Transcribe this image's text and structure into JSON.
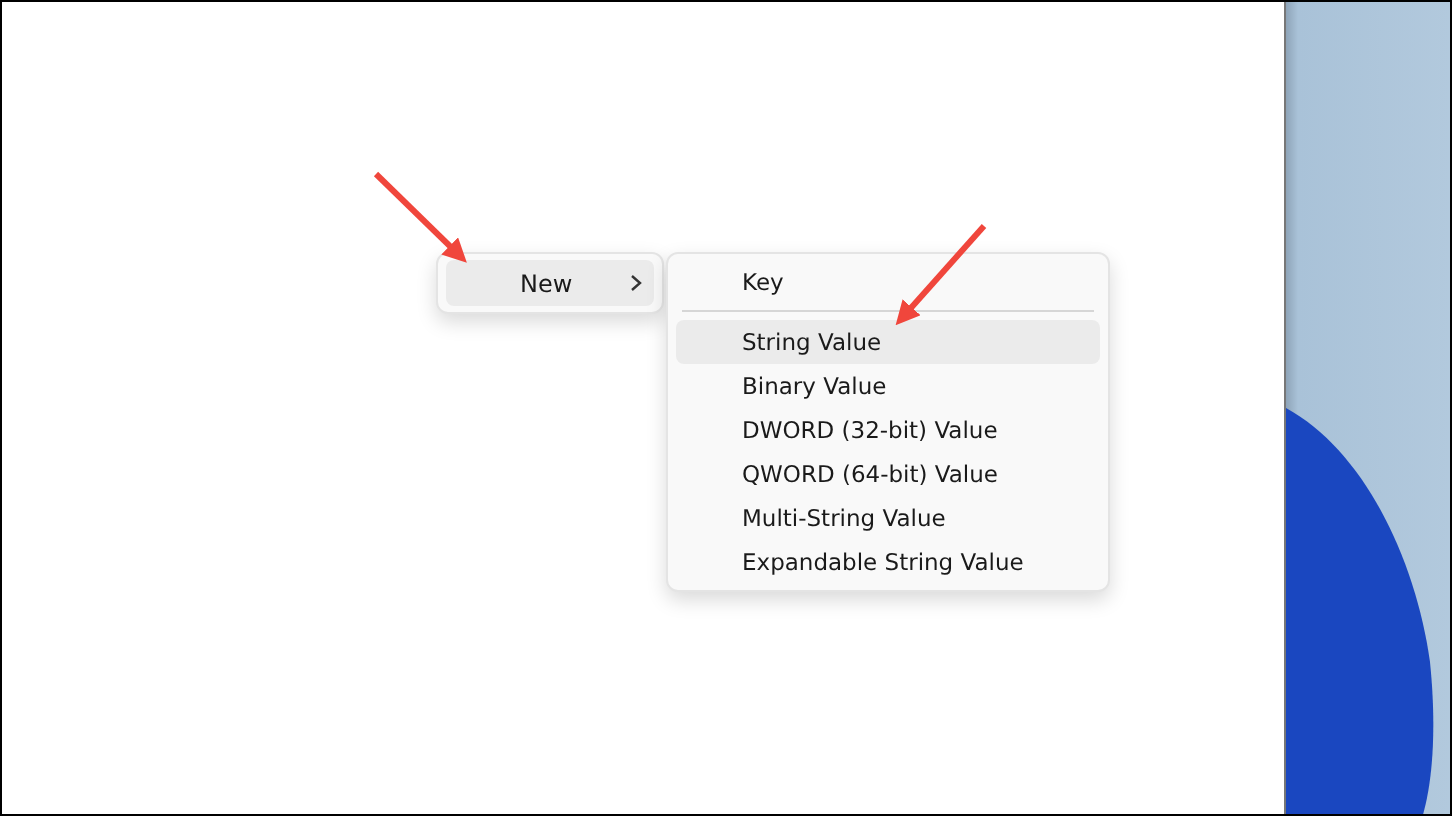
{
  "context_menu": {
    "items": [
      {
        "label": "New",
        "selected": true,
        "has_submenu": true
      }
    ]
  },
  "submenu": {
    "items": [
      {
        "kind": "item",
        "label": "Key",
        "selected": false
      },
      {
        "kind": "separator"
      },
      {
        "kind": "item",
        "label": "String Value",
        "selected": true
      },
      {
        "kind": "item",
        "label": "Binary Value",
        "selected": false
      },
      {
        "kind": "item",
        "label": "DWORD (32-bit) Value",
        "selected": false
      },
      {
        "kind": "item",
        "label": "QWORD (64-bit) Value",
        "selected": false
      },
      {
        "kind": "item",
        "label": "Multi-String Value",
        "selected": false
      },
      {
        "kind": "item",
        "label": "Expandable String Value",
        "selected": false
      }
    ]
  }
}
